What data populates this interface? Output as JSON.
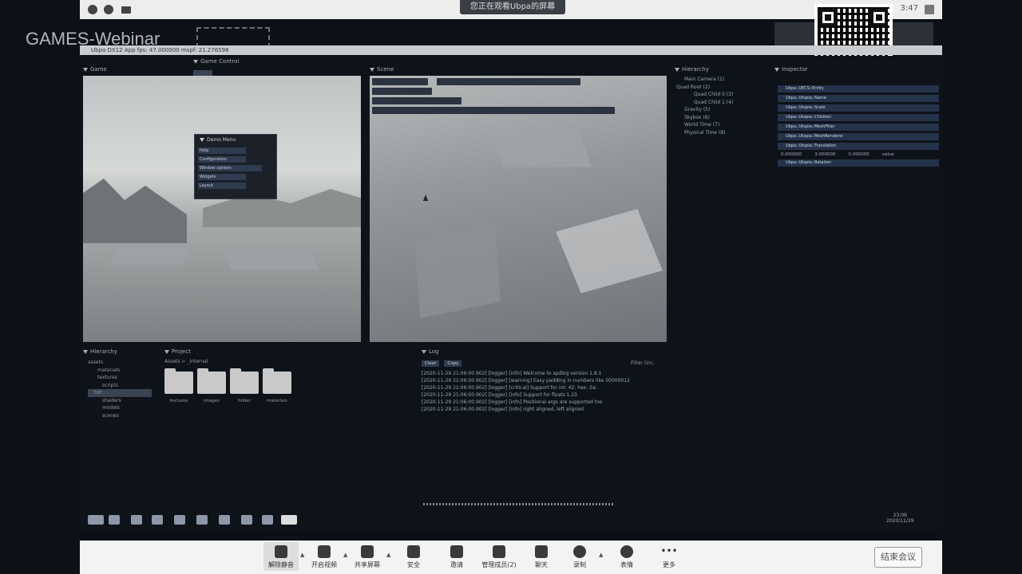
{
  "meeting_top": {
    "share_status": "您正在观看Ubpa的屏幕",
    "time": "3:47"
  },
  "watermark": {
    "text": "GAMES-Webinar"
  },
  "app": {
    "title": "Ubpa DX12 App   fps: 47.000000   mspf: 21.276596"
  },
  "panels": {
    "game": "Game",
    "scene": "Scene",
    "hierarchy": "Hierarchy",
    "inspector": "Inspector",
    "hierarchy_top": "Game Control",
    "project": "Project",
    "log": "Log",
    "log_filter": "Filter (inc,"
  },
  "demo_menu": {
    "title": "Demo Menu",
    "items": [
      "Help",
      "Configuration",
      "Window options",
      "Widgets",
      "Layout"
    ]
  },
  "hierarchy": {
    "items": [
      "Main Camera (1)",
      "Quad Root (2)",
      "Quad Child 0 (3)",
      "Quad Child 1 (4)",
      "Gravity (5)",
      "Skybox (6)",
      "World Time (7)",
      "Physical Time (8)"
    ]
  },
  "inspector": {
    "rows": [
      "Ubpa::UECS::Entity",
      "Ubpa::Utopia::Name",
      "Ubpa::Utopia::Scale",
      "Ubpa::Utopia::Children",
      "Ubpa::Utopia::MeshFilter",
      "Ubpa::Utopia::MeshRenderer",
      "Ubpa::Utopia::Translation",
      "Ubpa::Utopia::Rotation"
    ],
    "vec": [
      "0.000000",
      "3.000000",
      "0.000000",
      "value"
    ]
  },
  "project": {
    "tree": [
      "assets",
      "materials",
      "textures",
      "scripts",
      "hdr",
      "shaders",
      "models",
      "scenes"
    ],
    "path": "Assets > _internal",
    "folders": [
      "textures",
      "images",
      "folder",
      "materials"
    ]
  },
  "log": {
    "tabs": [
      "Clear",
      "Copy"
    ],
    "lines": [
      "[2020-11-29 21:06:00.902] [logger] [info] Welcome to spdlog version 1.8.1",
      "[2020-11-29 21:06:00.902] [logger] [warning] Easy padding in numbers like 00000012",
      "[2020-11-29 21:06:00.902] [logger] [critical] Support for int: 42; hex: 2a;",
      "[2020-11-29 21:06:00.902] [logger] [info] Support for floats 1.23",
      "[2020-11-29 21:06:00.902] [logger] [info] Positional args are supported too",
      "[2020-11-29 21:06:00.902] [logger] [info]    right aligned, left     aligned"
    ]
  },
  "taskbar": {
    "time": "23:06",
    "date": "2020/11/29"
  },
  "meeting_bar": {
    "items": [
      "解除静音",
      "开启视频",
      "共享屏幕",
      "安全",
      "邀请",
      "管理成员(2)",
      "聊天",
      "录制",
      "表情",
      "更多"
    ],
    "end": "结束会议"
  }
}
